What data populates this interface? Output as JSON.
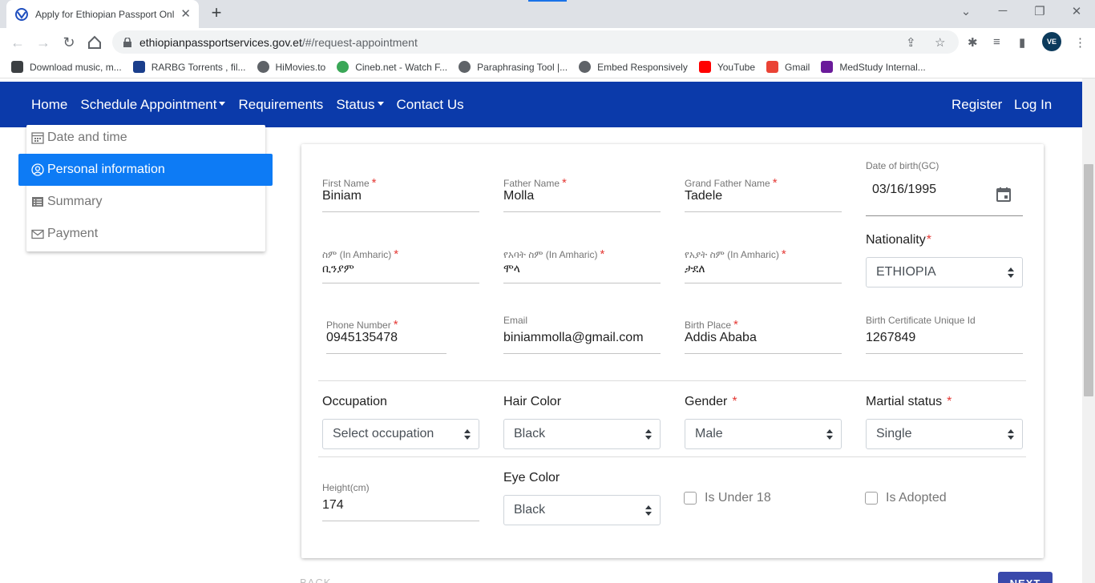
{
  "browser": {
    "tab_title": "Apply for Ethiopian Passport Onl",
    "url_domain": "ethiopianpassportservices.gov.et",
    "url_path": "/#/request-appointment",
    "profile_initials": "VE",
    "bookmarks": [
      {
        "label": "Download music, m...",
        "icon": "music-icon",
        "color": "#3c4043"
      },
      {
        "label": "RARBG Torrents , fil...",
        "icon": "rarbg-icon",
        "color": "#1a3e8c"
      },
      {
        "label": "HiMovies.to",
        "icon": "globe-icon",
        "color": "#5f6368"
      },
      {
        "label": "Cineb.net - Watch F...",
        "icon": "play-icon",
        "color": "#3aa757"
      },
      {
        "label": "Paraphrasing Tool |...",
        "icon": "globe-icon",
        "color": "#5f6368"
      },
      {
        "label": "Embed Responsively",
        "icon": "globe-icon",
        "color": "#5f6368"
      },
      {
        "label": "YouTube",
        "icon": "youtube-icon",
        "color": "#ff0000"
      },
      {
        "label": "Gmail",
        "icon": "gmail-icon",
        "color": "#ea4335"
      },
      {
        "label": "MedStudy Internal...",
        "icon": "medstudy-icon",
        "color": "#6a1b9a"
      }
    ]
  },
  "nav": {
    "home": "Home",
    "schedule": "Schedule Appointment",
    "requirements": "Requirements",
    "status": "Status",
    "contact": "Contact Us",
    "register": "Register",
    "login": "Log In",
    "brand_color": "#0b3aaa"
  },
  "steps": [
    {
      "label": "Date and time",
      "icon": "calendar-icon",
      "active": false
    },
    {
      "label": "Personal information",
      "icon": "user-circle-icon",
      "active": true
    },
    {
      "label": "Summary",
      "icon": "list-icon",
      "active": false
    },
    {
      "label": "Payment",
      "icon": "envelope-icon",
      "active": false
    }
  ],
  "form": {
    "first_name": {
      "label": "First Name",
      "value": "Biniam"
    },
    "father_name": {
      "label": "Father Name",
      "value": "Molla"
    },
    "grandfather_name": {
      "label": "Grand Father Name",
      "value": "Tadele"
    },
    "dob": {
      "label": "Date of birth(GC)",
      "value": "03/16/1995"
    },
    "am_first": {
      "label": "ስም (In Amharic)",
      "value": "ቢንያም"
    },
    "am_father": {
      "label": "የአባት ስም (In Amharic)",
      "value": "ሞላ"
    },
    "am_grandfather": {
      "label": "የአያት ስም (In Amharic)",
      "value": "ታደለ"
    },
    "nationality": {
      "label": "Nationality",
      "value": "ETHIOPIA"
    },
    "phone": {
      "label": "Phone Number",
      "value": "0945135478"
    },
    "email": {
      "label": "Email",
      "value": "biniammolla@gmail.com"
    },
    "birth_place": {
      "label": "Birth Place",
      "value": "Addis Ababa"
    },
    "birth_cert": {
      "label": "Birth Certificate Unique Id",
      "value": "1267849"
    },
    "occupation": {
      "label": "Occupation",
      "value": "Select occupation"
    },
    "hair_color": {
      "label": "Hair Color",
      "value": "Black"
    },
    "gender": {
      "label": "Gender",
      "value": "Male"
    },
    "marital": {
      "label": "Martial status",
      "value": "Single"
    },
    "height": {
      "label": "Height(cm)",
      "value": "174"
    },
    "eye_color": {
      "label": "Eye Color",
      "value": "Black"
    },
    "under18": {
      "label": "Is Under 18",
      "checked": false
    },
    "adopted": {
      "label": "Is Adopted",
      "checked": false
    },
    "required_mark": "*"
  },
  "buttons": {
    "back": "BACK",
    "next": "NEXT"
  }
}
